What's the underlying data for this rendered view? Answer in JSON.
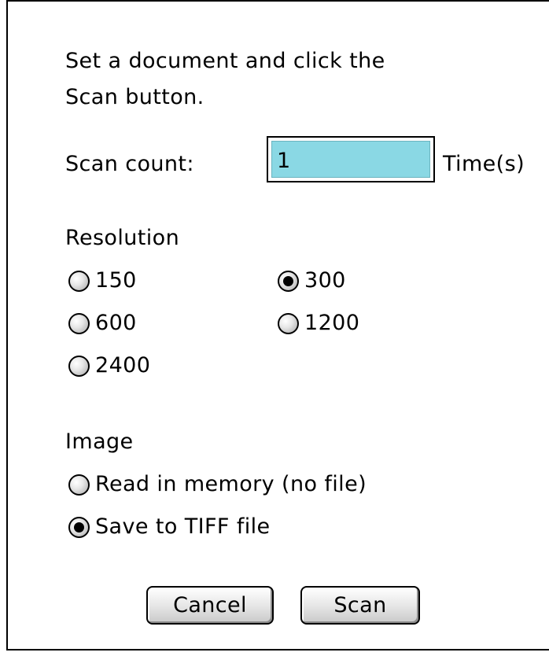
{
  "dialog": {
    "instruction_line1": "Set a document and click the",
    "instruction_line2": "Scan button."
  },
  "scan_count": {
    "label": "Scan count:",
    "value": "1",
    "unit": "Time(s)"
  },
  "resolution": {
    "label": "Resolution",
    "options": [
      {
        "label": "150",
        "checked": false
      },
      {
        "label": "300",
        "checked": true
      },
      {
        "label": "600",
        "checked": false
      },
      {
        "label": "1200",
        "checked": false
      },
      {
        "label": "2400",
        "checked": false
      }
    ]
  },
  "image": {
    "label": "Image",
    "options": [
      {
        "label": "Read in memory (no file)",
        "checked": false
      },
      {
        "label": "Save to TIFF file",
        "checked": true
      }
    ]
  },
  "buttons": {
    "cancel": "Cancel",
    "scan": "Scan"
  },
  "colors": {
    "field_background": "#8ad8e4",
    "window_border": "#000000"
  },
  "icons": {
    "radio_unchecked": "radio-unchecked-icon",
    "radio_checked": "radio-checked-icon"
  }
}
